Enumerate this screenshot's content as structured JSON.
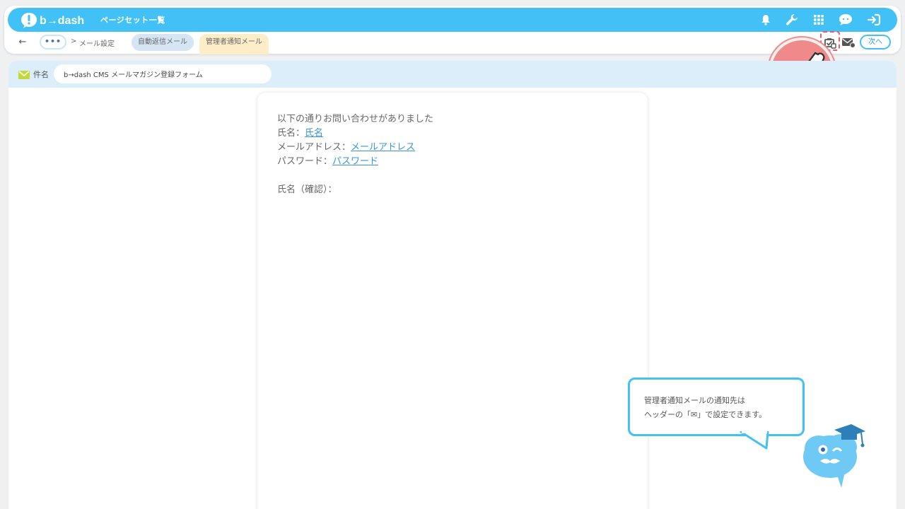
{
  "header": {
    "logo_text": "b→dash",
    "title": "ページセット一覧",
    "icons": [
      "bell-icon",
      "wrench-icon",
      "grid-icon",
      "chat-bubble-icon",
      "logout-icon"
    ]
  },
  "breadcrumb": {
    "back_icon": "arrow-left-icon",
    "more_label": "•••",
    "separator": ">",
    "current": "メール設定"
  },
  "tabs": {
    "auto_reply": "自動返信メール",
    "admin_notify": "管理者通知メール"
  },
  "actions": {
    "icons": [
      "notify-settings-icon",
      "mail-settings-icon"
    ],
    "next_label": "次へ"
  },
  "subject": {
    "label": "件名",
    "value": "b→dash CMS メールマガジン登録フォーム"
  },
  "mail_body": {
    "intro": "以下の通りお問い合わせがありました",
    "fields": [
      {
        "label": "氏名：",
        "var": "氏名"
      },
      {
        "label": "メールアドレス：",
        "var": "メールアドレス"
      },
      {
        "label": "パスワード：",
        "var": "パスワード"
      }
    ],
    "confirm_label": "氏名（確認）："
  },
  "tooltip": {
    "line1": "管理者通知メールの通知先は",
    "line2": "ヘッダーの「✉」で設定できます。"
  },
  "colors": {
    "header": "#41c1f5",
    "subject_bar": "#dceefa",
    "auto_tab": "#d5e5f3",
    "admin_tab": "#fdedc9",
    "link": "#3a95d8",
    "highlight": "#ef5a6a"
  }
}
